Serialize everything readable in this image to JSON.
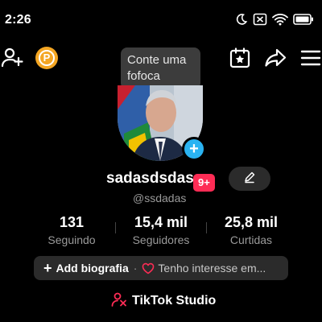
{
  "status_bar": {
    "time": "2:26",
    "icons": [
      "moon-icon",
      "mute-icon",
      "wifi-icon",
      "battery-icon"
    ]
  },
  "top_bar": {
    "icons": [
      "add-friend-icon",
      "points-icon",
      "calendar-icon",
      "share-icon",
      "menu-icon"
    ],
    "points_letter": "P"
  },
  "tooltip": {
    "text": "Conte uma fofoca"
  },
  "profile": {
    "username": "sadasdsdas",
    "badge": "9+",
    "handle": "@ssdadas",
    "avatar_add_icon": "plus-icon"
  },
  "stats": [
    {
      "value": "131",
      "label": "Seguindo"
    },
    {
      "value": "15,4 mil",
      "label": "Seguidores"
    },
    {
      "value": "25,8 mil",
      "label": "Curtidas"
    }
  ],
  "bio": {
    "add_label": "Add biografia",
    "separator": "·",
    "interest_label": "Tenho interesse em..."
  },
  "studio": {
    "label": "TikTok Studio"
  },
  "colors": {
    "background": "#000000",
    "accent_red": "#fe2c55",
    "accent_blue": "#2ab3f2",
    "points_orange": "#f4a623",
    "chip_gray": "#2b2b2b",
    "secondary_text": "#9a9a9a"
  }
}
